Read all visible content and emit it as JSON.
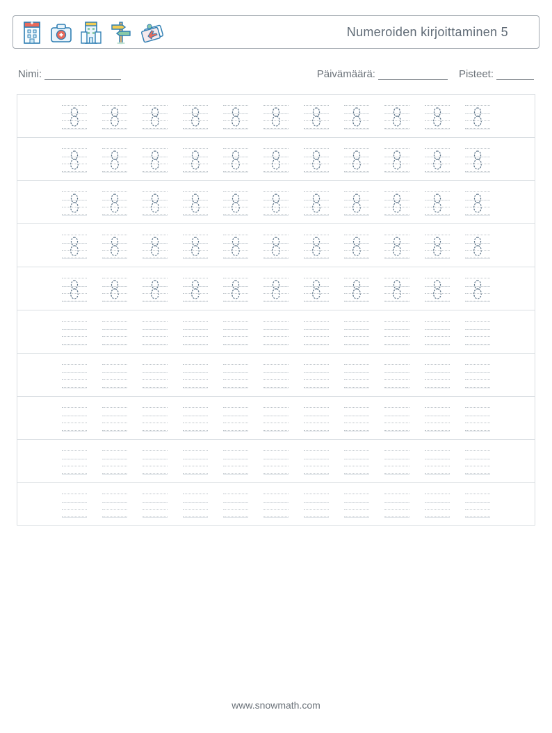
{
  "title": "Numeroiden kirjoittaminen 5",
  "fields": {
    "name_label": "Nimi:",
    "date_label": "Päivämäärä:",
    "score_label": "Pisteet:"
  },
  "worksheet": {
    "digit": "8",
    "columns": 11,
    "rows_with_trace_digit": 5,
    "rows_blank_practice": 5
  },
  "icons": [
    "hospital-building-icon",
    "medical-case-icon",
    "office-building-icon",
    "signpost-icon",
    "airplane-tickets-icon"
  ],
  "footer": "www.snowmath.com"
}
